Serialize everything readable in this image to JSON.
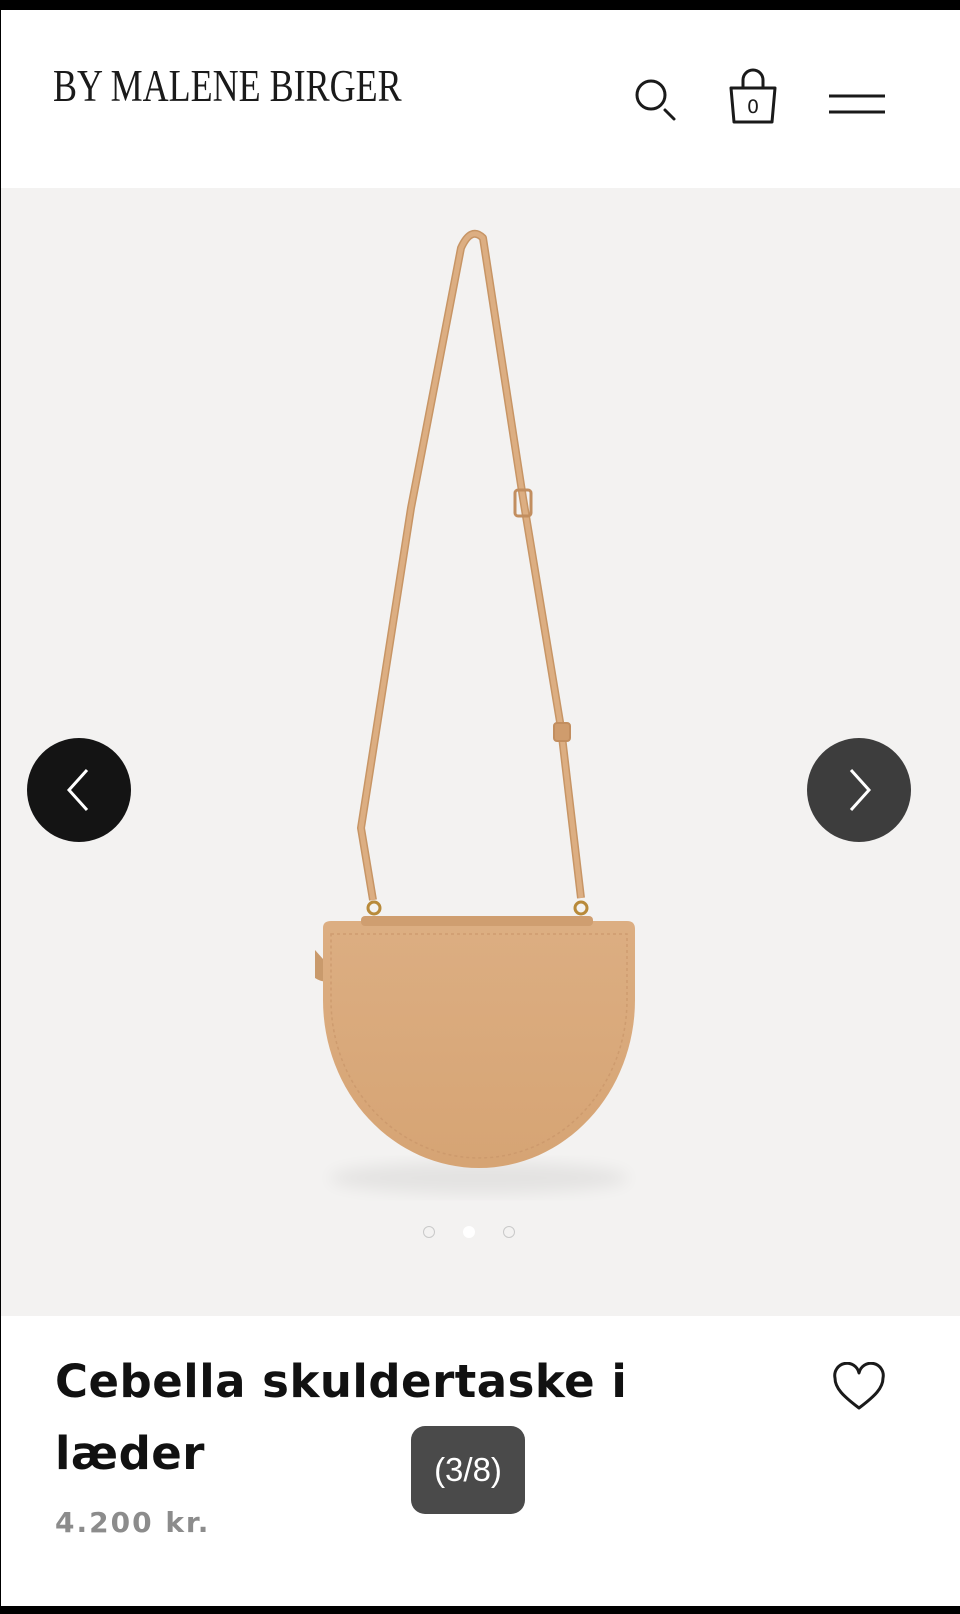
{
  "header": {
    "brand": "BY MALENE BIRGER",
    "cart_count": "0",
    "icons": [
      "search-icon",
      "bag-icon",
      "menu-icon"
    ]
  },
  "gallery": {
    "image_position": "3/8",
    "counter_label": "(3/8)",
    "dots_total": 3,
    "dots_active": 2,
    "icons": [
      "chevron-left-icon",
      "chevron-right-icon"
    ]
  },
  "product": {
    "title": "Cebella skuldertaske i læder",
    "price": "4.200 kr.",
    "icons": [
      "heart-icon"
    ]
  },
  "colors": {
    "background": "#ffffff",
    "gallery_bg": "#f3f2f1",
    "bag_leather": "#d9a878",
    "nav_prev": "#141414",
    "nav_next": "#3d3d3d",
    "price": "#8c8c8c"
  }
}
